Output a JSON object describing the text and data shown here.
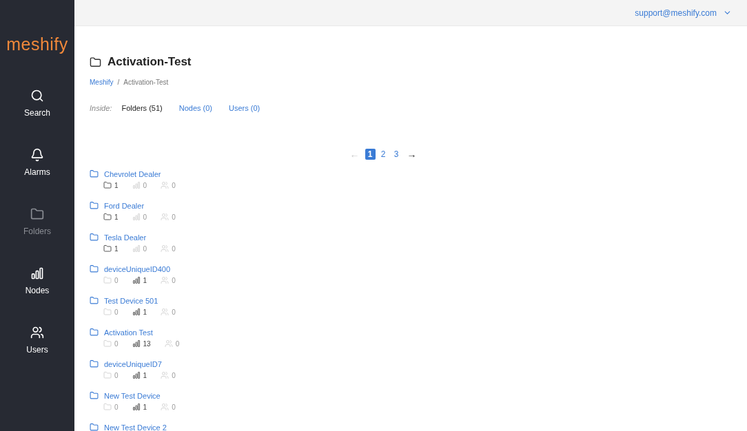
{
  "logo": "meshify",
  "sidebar": {
    "items": [
      {
        "kind": "search",
        "label": "Search",
        "selected": false
      },
      {
        "kind": "alarms",
        "label": "Alarms",
        "selected": false
      },
      {
        "kind": "folders",
        "label": "Folders",
        "selected": true
      },
      {
        "kind": "nodes",
        "label": "Nodes",
        "selected": false
      },
      {
        "kind": "users",
        "label": "Users",
        "selected": false
      }
    ]
  },
  "account": {
    "email": "support@meshify.com"
  },
  "title": "Activation-Test",
  "breadcrumb": [
    {
      "label": "Meshify",
      "link": true
    },
    {
      "label": "Activation-Test",
      "link": false
    }
  ],
  "breadcrumb_separator": "/",
  "inside": {
    "label": "Inside:",
    "tabs": [
      {
        "label": "Folders (51)",
        "selected": true
      },
      {
        "label": "Nodes (0)",
        "selected": false
      },
      {
        "label": "Users (0)",
        "selected": false
      }
    ]
  },
  "pagination": {
    "prev": {
      "label": "←",
      "disabled": true
    },
    "pages": [
      {
        "label": "1",
        "selected": true
      },
      {
        "label": "2",
        "selected": false
      },
      {
        "label": "3",
        "selected": false
      }
    ],
    "next": {
      "label": "→",
      "disabled": false
    }
  },
  "folders": [
    {
      "name": "Chevrolet Dealer",
      "stats": [
        {
          "kind": "folders",
          "count": "1",
          "empty": false
        },
        {
          "kind": "nodes",
          "count": "0",
          "empty": true
        },
        {
          "kind": "users",
          "count": "0",
          "empty": true
        }
      ]
    },
    {
      "name": "Ford Dealer",
      "stats": [
        {
          "kind": "folders",
          "count": "1",
          "empty": false
        },
        {
          "kind": "nodes",
          "count": "0",
          "empty": true
        },
        {
          "kind": "users",
          "count": "0",
          "empty": true
        }
      ]
    },
    {
      "name": "Tesla Dealer",
      "stats": [
        {
          "kind": "folders",
          "count": "1",
          "empty": false
        },
        {
          "kind": "nodes",
          "count": "0",
          "empty": true
        },
        {
          "kind": "users",
          "count": "0",
          "empty": true
        }
      ]
    },
    {
      "name": "deviceUniqueID400",
      "stats": [
        {
          "kind": "folders",
          "count": "0",
          "empty": true
        },
        {
          "kind": "nodes",
          "count": "1",
          "empty": false
        },
        {
          "kind": "users",
          "count": "0",
          "empty": true
        }
      ]
    },
    {
      "name": "Test Device 501",
      "stats": [
        {
          "kind": "folders",
          "count": "0",
          "empty": true
        },
        {
          "kind": "nodes",
          "count": "1",
          "empty": false
        },
        {
          "kind": "users",
          "count": "0",
          "empty": true
        }
      ]
    },
    {
      "name": "Activation Test",
      "stats": [
        {
          "kind": "folders",
          "count": "0",
          "empty": true
        },
        {
          "kind": "nodes",
          "count": "13",
          "empty": false
        },
        {
          "kind": "users",
          "count": "0",
          "empty": true
        }
      ]
    },
    {
      "name": "deviceUniqueID7",
      "stats": [
        {
          "kind": "folders",
          "count": "0",
          "empty": true
        },
        {
          "kind": "nodes",
          "count": "1",
          "empty": false
        },
        {
          "kind": "users",
          "count": "0",
          "empty": true
        }
      ]
    },
    {
      "name": "New Test Device",
      "stats": [
        {
          "kind": "folders",
          "count": "0",
          "empty": true
        },
        {
          "kind": "nodes",
          "count": "1",
          "empty": false
        },
        {
          "kind": "users",
          "count": "0",
          "empty": true
        }
      ]
    },
    {
      "name": "New Test Device 2"
    }
  ]
}
